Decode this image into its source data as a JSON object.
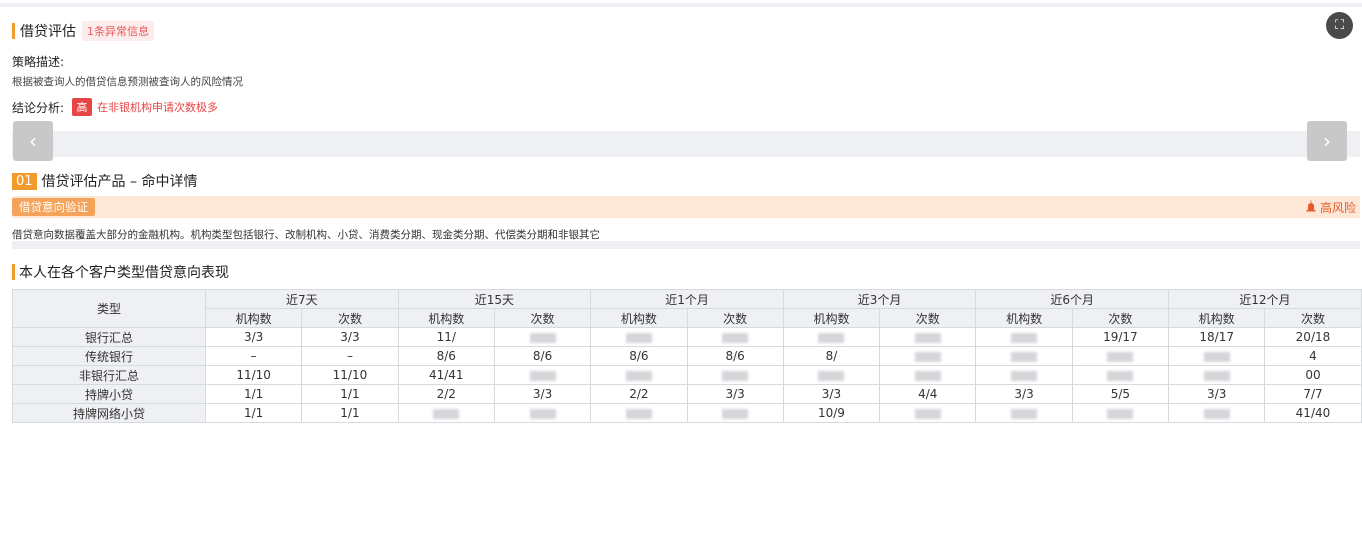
{
  "section1": {
    "title": "借贷评估",
    "abnormal_tag": "1条异常信息",
    "strategy_label": "策略描述:",
    "strategy_desc": "根据被查询人的借贷信息预测被查询人的风险情况",
    "conclusion_label": "结论分析:",
    "level_badge": "高",
    "conclusion_text": "在非银机构申请次数极多"
  },
  "nav": {
    "prev": "‹",
    "next": "›"
  },
  "camera_icon": "⛶",
  "section2": {
    "num": "01",
    "title": "借贷评估产品 – 命中详情",
    "verify_tag": "借贷意向验证",
    "risk_icon": "alarm-icon",
    "risk_label": "高风险",
    "description": "借贷意向数据覆盖大部分的金融机构。机构类型包括银行、改制机构、小贷、消费类分期、现金类分期、代偿类分期和非银其它"
  },
  "section3": {
    "title": "本人在各个客户类型借贷意向表现",
    "type_header": "类型",
    "periods": [
      "近7天",
      "近15天",
      "近1个月",
      "近3个月",
      "近6个月",
      "近12个月"
    ],
    "sub_headers": [
      "机构数",
      "次数",
      "机构数",
      "次数",
      "机构数",
      "次数",
      "机构数",
      "次数",
      "机构数",
      "次数",
      "机构数",
      "次数"
    ],
    "rows": [
      {
        "label": "银行汇总",
        "cells": [
          "3/3",
          "3/3",
          "11/",
          "",
          "",
          "",
          "",
          "",
          "",
          "19/17",
          "18/17",
          "20/18"
        ]
      },
      {
        "label": "传统银行",
        "cells": [
          "–",
          "–",
          "8/6",
          "8/6",
          "8/6",
          "8/6",
          "8/",
          "",
          "",
          "",
          "",
          "4"
        ]
      },
      {
        "label": "非银行汇总",
        "cells": [
          "11/10",
          "11/10",
          "41/41",
          "",
          "",
          "",
          "",
          "",
          "",
          "",
          "",
          "00"
        ]
      },
      {
        "label": "持牌小贷",
        "cells": [
          "1/1",
          "1/1",
          "2/2",
          "3/3",
          "2/2",
          "3/3",
          "3/3",
          "4/4",
          "3/3",
          "5/5",
          "3/3",
          "7/7"
        ]
      },
      {
        "label": "持牌网络小贷",
        "cells": [
          "1/1",
          "1/1",
          "",
          "",
          "",
          "",
          "10/9",
          "",
          "",
          "",
          "",
          "41/40"
        ]
      }
    ]
  }
}
